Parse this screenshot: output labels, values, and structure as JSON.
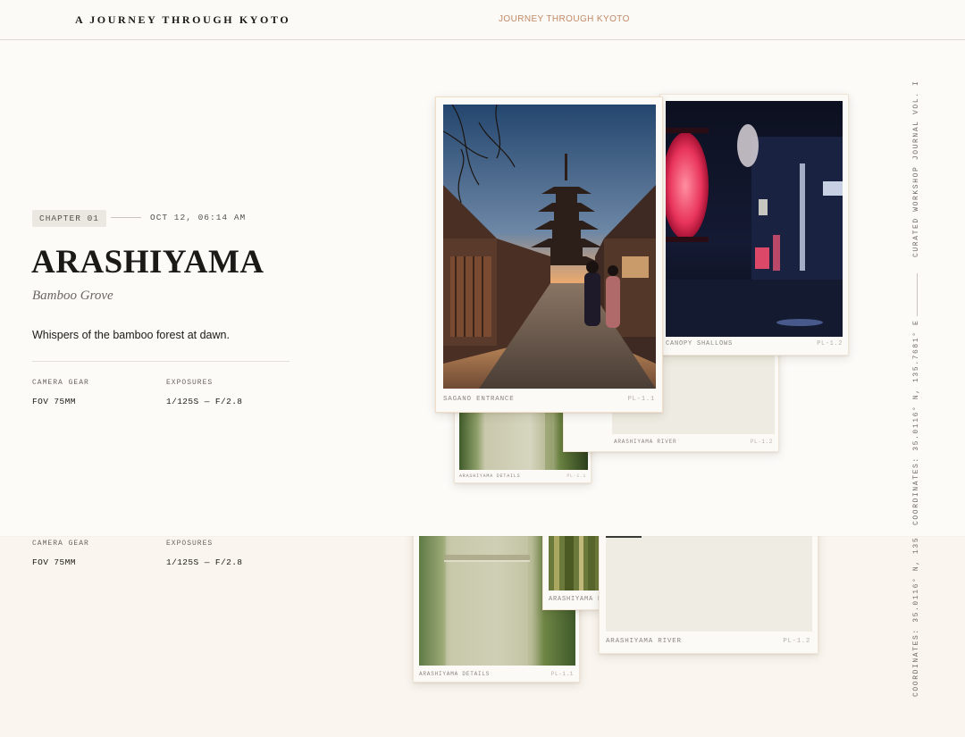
{
  "header": {
    "brand": "A JOURNEY THROUGH KYOTO",
    "nav_link": "JOURNEY THROUGH KYOTO"
  },
  "chapter": {
    "badge": "CHAPTER 01",
    "date": "OCT 12, 06:14 AM",
    "title": "ARASHIYAMA",
    "subtitle": "Bamboo Grove",
    "description": "Whispers of the bamboo forest at dawn.",
    "specs": [
      {
        "label": "CAMERA GEAR",
        "value": "FOV 75MM"
      },
      {
        "label": "EXPOSURES",
        "value": "1/125S — F/2.8"
      }
    ]
  },
  "lower_specs": [
    {
      "label": "CAMERA GEAR",
      "value": "FOV 75MM"
    },
    {
      "label": "EXPOSURES",
      "value": "1/125S — F/2.8"
    }
  ],
  "cards": {
    "sagano": {
      "caption": "SAGANO ENTRANCE",
      "ref": "PL-1.1"
    },
    "canopy": {
      "caption": "CANOPY SHALLOWS",
      "ref": "PL-1.2"
    },
    "river_small": {
      "caption": "ARASHIYAMA RIVER",
      "ref": "PL-1.2"
    },
    "details_small": {
      "caption": "ARASHIYAMA DETAILS",
      "ref": "PL-1.1"
    },
    "details_lower": {
      "caption": "ARASHIYAMA DETAILS",
      "ref": "PL-1.1"
    },
    "bamboo_lower": {
      "caption": "ARASHIYAMA B"
    },
    "river_lower": {
      "caption": "ARASHIYAMA RIVER",
      "ref": "PL-1.2"
    }
  },
  "side": {
    "journal": "CURATED WORKSHOP JOURNAL VOL. I",
    "coordinates_top": "COORDINATES: 35.0116° N, 135.7681° E",
    "coordinates_bottom": "COORDINATES: 35.0116° N, 135"
  },
  "colors": {
    "accent": "#c28a66",
    "ink": "#1c1a17",
    "paper": "#fcfbf8"
  }
}
